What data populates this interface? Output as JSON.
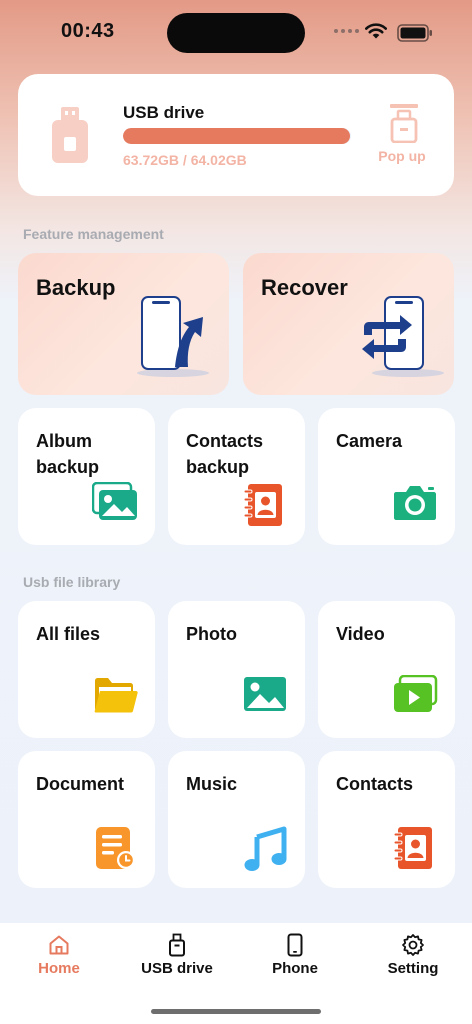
{
  "status": {
    "time": "00:43"
  },
  "usb": {
    "title": "USB drive",
    "storage_text": "63.72GB / 64.02GB",
    "used_fraction": 0.995,
    "popup_label": "Pop up"
  },
  "sections": {
    "feature": "Feature management",
    "library": "Usb file library"
  },
  "features": {
    "backup": "Backup",
    "recover": "Recover",
    "album": "Album backup",
    "contacts": "Contacts backup",
    "camera": "Camera"
  },
  "library": {
    "all_files": "All files",
    "photo": "Photo",
    "video": "Video",
    "document": "Document",
    "music": "Music",
    "contacts": "Contacts"
  },
  "tabs": [
    {
      "label": "Home",
      "active": true
    },
    {
      "label": "USB drive",
      "active": false
    },
    {
      "label": "Phone",
      "active": false
    },
    {
      "label": "Setting",
      "active": false
    }
  ],
  "colors": {
    "accent": "#e67a5f",
    "accent_light": "#f3b4a5",
    "album_green": "#1aaa8a",
    "contacts_orange": "#e8552a",
    "camera_green": "#1db07f",
    "folder_yellow": "#f5c20b",
    "video_green": "#57c224",
    "doc_orange": "#f8962c",
    "music_blue": "#3fb0f0",
    "phone_blue": "#1e3f8c"
  }
}
